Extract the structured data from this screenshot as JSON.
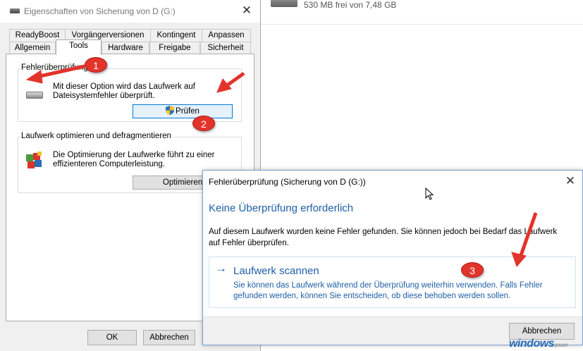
{
  "background": {
    "free_space": "530 MB frei von 7,48 GB"
  },
  "properties": {
    "title": "Eigenschaften von Sicherung von D (G:)",
    "close_glyph": "✕",
    "tabs_row1": [
      "ReadyBoost",
      "Vorgängerversionen",
      "Kontingent",
      "Anpassen"
    ],
    "tabs_row2": [
      "Allgemein",
      "Tools",
      "Hardware",
      "Freigabe",
      "Sicherheit"
    ],
    "active_tab": "Tools",
    "error_check": {
      "legend": "Fehlerüberprüfung",
      "text_line1": "Mit dieser Option wird das Laufwerk auf",
      "text_line2": "Dateisystemfehler überprüft.",
      "button": "Prüfen"
    },
    "optimize": {
      "legend": "Laufwerk optimieren und defragmentieren",
      "text_line1": "Die Optimierung der Laufwerke führt zu einer",
      "text_line2": "effizienteren Computerleistung.",
      "button": "Optimieren"
    },
    "ok_button": "OK",
    "cancel_button": "Abbrechen"
  },
  "check_dialog": {
    "title": "Fehlerüberprüfung (Sicherung von D (G:))",
    "close_glyph": "✕",
    "heading": "Keine Überprüfung erforderlich",
    "body_line1": "Auf diesem Laufwerk wurden keine Fehler gefunden. Sie können jedoch bei Bedarf das Laufwerk",
    "body_line2": "auf Fehler überprüfen.",
    "scan_arrow": "→",
    "scan_title": "Laufwerk scannen",
    "scan_desc_line1": "Sie können das Laufwerk während der Überprüfung weiterhin verwenden. Falls Fehler",
    "scan_desc_line2": "gefunden werden, können Sie entscheiden, ob diese behoben werden sollen.",
    "cancel_button": "Abbrechen"
  },
  "annotations": {
    "badge1": "1",
    "badge2": "2",
    "badge3": "3",
    "color": "#e2342b"
  },
  "watermark": {
    "brand": "windows",
    "suffix": "power"
  },
  "colors": {
    "accent": "#1e5fa6",
    "focus": "#0078d7"
  }
}
